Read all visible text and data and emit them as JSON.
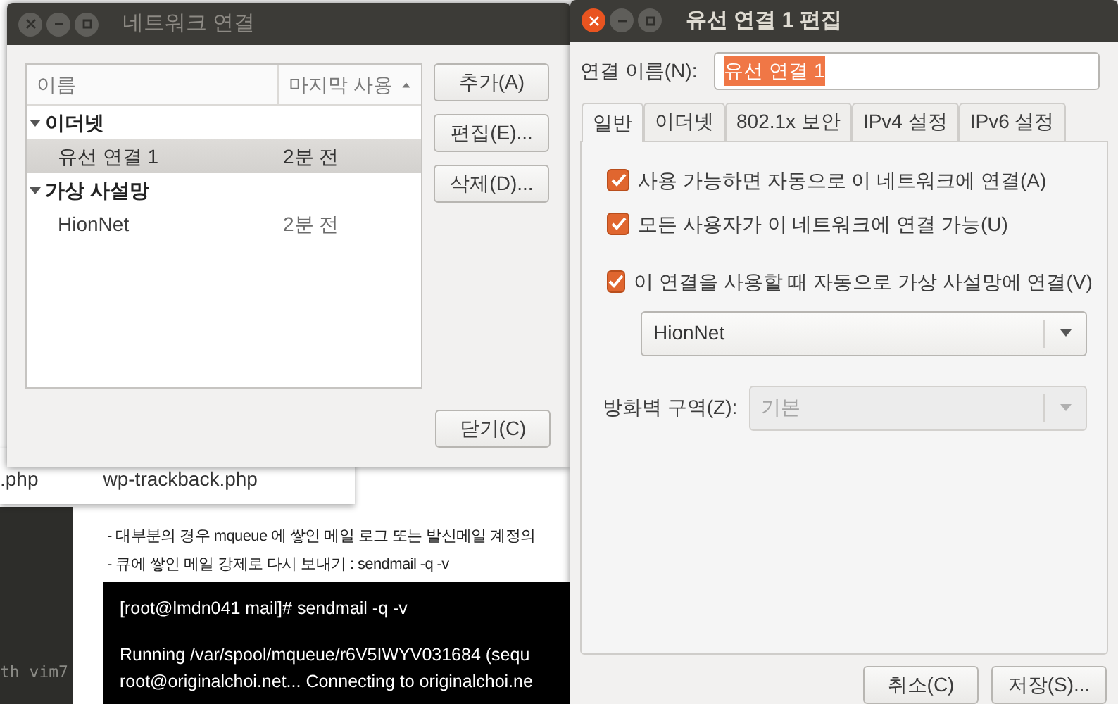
{
  "background": {
    "file_list": [
      ".php",
      "wp-trackback.php"
    ],
    "editor_text": "th vim7",
    "article_lines": [
      "- 대부분의 경우 mqueue 에 쌓인 메일 로그 또는 발신메일 계정의",
      "- 큐에 쌓인 메일 강제로 다시 보내기 : sendmail -q  -v"
    ],
    "terminal_blocks": [
      [
        "[root@lmdn041 mail]# sendmail -q -v"
      ],
      [
        "Running /var/spool/mqueue/r6V5IWYV031684 (sequ",
        "root@originalchoi.net... Connecting to originalchoi.ne"
      ]
    ]
  },
  "connections_window": {
    "title": "네트워크 연결",
    "active": false,
    "columns": [
      {
        "label": "이름",
        "sorted": false
      },
      {
        "label": "마지막 사용",
        "sorted": true
      }
    ],
    "groups": [
      {
        "label": "이더넷",
        "expanded": true,
        "children": [
          {
            "name": "유선 연결 1",
            "last_used": "2분 전",
            "selected": true
          }
        ]
      },
      {
        "label": "가상 사설망",
        "expanded": true,
        "children": [
          {
            "name": "HionNet",
            "last_used": "2분 전",
            "selected": false
          }
        ]
      }
    ],
    "buttons": [
      "추가(A)",
      "편집(E)...",
      "삭제(D)..."
    ],
    "close_button": "닫기(C)"
  },
  "editor_window": {
    "title": "유선 연결 1 편집",
    "active": true,
    "name_label": "연결 이름(N):",
    "name_value": "유선 연결 1",
    "name_value_selected": true,
    "tabs": [
      {
        "label": "일반",
        "selected": true
      },
      {
        "label": "이더넷",
        "selected": false
      },
      {
        "label": "802.1x 보안",
        "selected": false
      },
      {
        "label": "IPv4 설정",
        "selected": false
      },
      {
        "label": "IPv6 설정",
        "selected": false
      }
    ],
    "checkboxes": [
      {
        "label": "사용 가능하면 자동으로 이 네트워크에 연결(A)",
        "checked": true
      },
      {
        "label": "모든 사용자가 이 네트워크에 연결 가능(U)",
        "checked": true
      },
      {
        "label": "이 연결을 사용할 때 자동으로 가상 사설망에 연결(V)",
        "checked": true
      }
    ],
    "vpn_dropdown": {
      "value": "HionNet",
      "disabled": false
    },
    "firewall_label": "방화벽 구역(Z):",
    "firewall_dropdown": {
      "value": "기본",
      "disabled": true
    },
    "buttons": [
      "취소(C)",
      "저장(S)..."
    ]
  }
}
